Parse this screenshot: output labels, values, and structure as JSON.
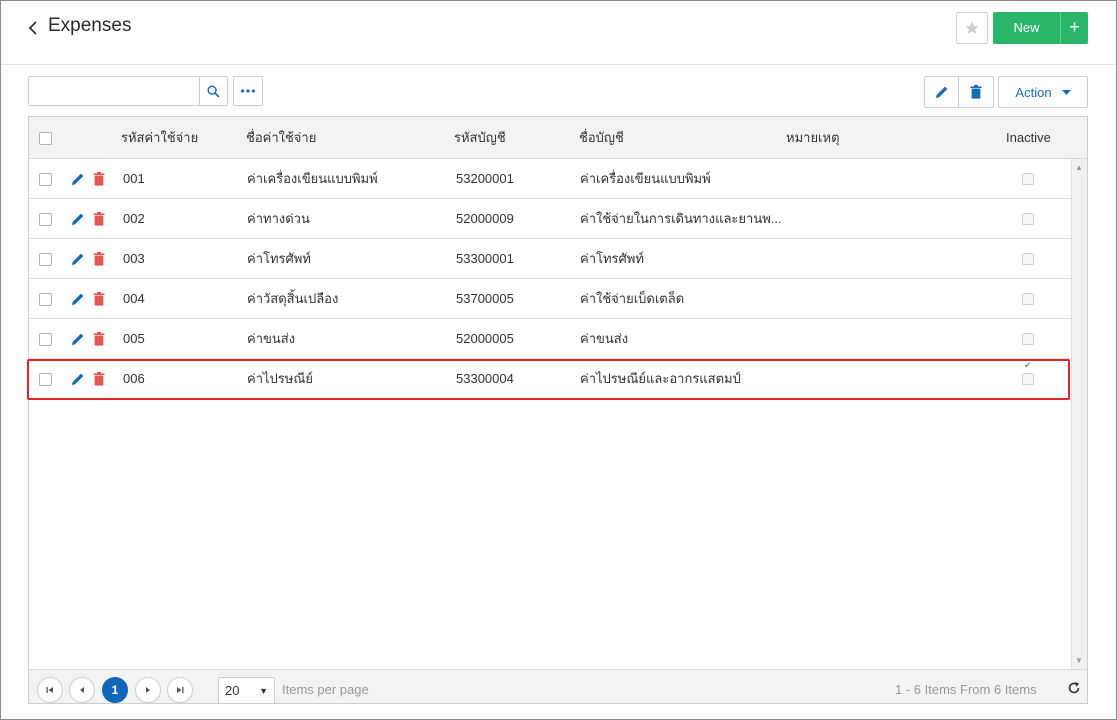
{
  "header": {
    "title": "Expenses",
    "new_label": "New",
    "new_plus": "+"
  },
  "toolbar": {
    "search_value": "",
    "search_placeholder": "",
    "more_label": "•••",
    "action_label": "Action"
  },
  "grid": {
    "columns": {
      "code": "รหัสค่าใช้จ่าย",
      "name": "ชื่อค่าใช้จ่าย",
      "account_code": "รหัสบัญชี",
      "account_name": "ชื่อบัญชี",
      "note": "หมายเหตุ",
      "inactive": "Inactive"
    },
    "rows": [
      {
        "code": "001",
        "name": "ค่าเครื่องเขียนแบบพิมพ์",
        "account_code": "53200001",
        "account_name": "ค่าเครื่องเขียนแบบพิมพ์",
        "note": "",
        "inactive": false
      },
      {
        "code": "002",
        "name": "ค่าทางด่วน",
        "account_code": "52000009",
        "account_name": "ค่าใช้จ่ายในการเดินทางและยานพ...",
        "note": "",
        "inactive": false
      },
      {
        "code": "003",
        "name": "ค่าโทรศัพท์",
        "account_code": "53300001",
        "account_name": "ค่าโทรศัพท์",
        "note": "",
        "inactive": false
      },
      {
        "code": "004",
        "name": "ค่าวัสดุสิ้นเปลือง",
        "account_code": "53700005",
        "account_name": "ค่าใช้จ่ายเบ็ดเตล็ด",
        "note": "",
        "inactive": false
      },
      {
        "code": "005",
        "name": "ค่าขนส่ง",
        "account_code": "52000005",
        "account_name": "ค่าขนส่ง",
        "note": "",
        "inactive": false
      },
      {
        "code": "006",
        "name": "ค่าไปรษณีย์",
        "account_code": "53300004",
        "account_name": "ค่าไปรษณีย์และอากรแสตมป์",
        "note": "",
        "inactive": true
      }
    ],
    "highlighted_row_index": 5
  },
  "pager": {
    "current_page": "1",
    "page_size": "20",
    "items_per_page_label": "Items per page",
    "info": "1 - 6 Items From 6 Items"
  },
  "colors": {
    "accent_blue": "#1266b8",
    "new_green": "#2bb56b",
    "delete_red": "#e25555",
    "highlight_red": "#e0242c"
  },
  "icons": [
    "back-chevron-icon",
    "star-icon",
    "search-icon",
    "more-icon",
    "pencil-icon",
    "trash-icon",
    "caret-down-icon",
    "first-page-icon",
    "prev-page-icon",
    "next-page-icon",
    "last-page-icon",
    "refresh-icon"
  ]
}
